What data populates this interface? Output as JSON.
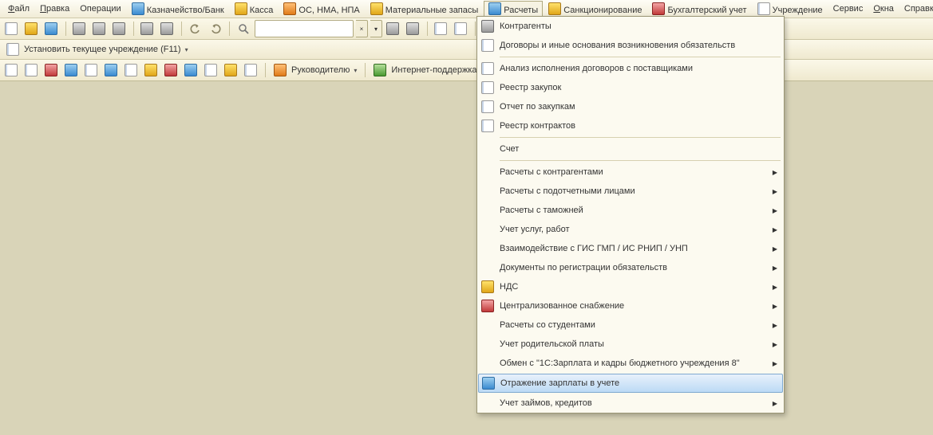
{
  "menubar": {
    "items": [
      {
        "label": "Файл",
        "underline": 0
      },
      {
        "label": "Правка",
        "underline": 0
      },
      {
        "label": "Операции"
      },
      {
        "label": "Казначейство/Банк",
        "icon": "blue"
      },
      {
        "label": "Касса",
        "icon": "yellow"
      },
      {
        "label": "ОС, НМА, НПА",
        "icon": "orange"
      },
      {
        "label": "Материальные запасы",
        "icon": "yellow"
      },
      {
        "label": "Расчеты",
        "icon": "blue",
        "active": true
      },
      {
        "label": "Санкционирование",
        "icon": "yellow"
      },
      {
        "label": "Бухгалтерский учет",
        "icon": "red"
      },
      {
        "label": "Учреждение",
        "icon": "paper"
      },
      {
        "label": "Сервис"
      },
      {
        "label": "Окна",
        "underline": 0
      },
      {
        "label": "Справка"
      }
    ]
  },
  "toolbar2_label": "Установить текущее учреждение (F11)",
  "toolbar3": {
    "leader_label": "Руководителю",
    "support_label": "Интернет-поддержка"
  },
  "dropdown": {
    "items": [
      {
        "label": "Контрагенты",
        "icon": "gray"
      },
      {
        "label": "Договоры и иные основания возникновения обязательств",
        "icon": "paper"
      },
      {
        "sep": true
      },
      {
        "label": "Анализ исполнения договоров с поставщиками",
        "icon": "paper"
      },
      {
        "label": "Реестр закупок",
        "icon": "paper"
      },
      {
        "label": "Отчет по закупкам",
        "icon": "paper"
      },
      {
        "label": "Реестр контрактов",
        "icon": "paper"
      },
      {
        "sep": true
      },
      {
        "label": "Счет"
      },
      {
        "sep": true
      },
      {
        "label": "Расчеты с контрагентами",
        "sub": true
      },
      {
        "label": "Расчеты с подотчетными лицами",
        "sub": true
      },
      {
        "label": "Расчеты с таможней",
        "sub": true
      },
      {
        "label": "Учет услуг, работ",
        "sub": true
      },
      {
        "label": "Взаимодействие с ГИС ГМП / ИС РНИП / УНП",
        "sub": true
      },
      {
        "label": "Документы по регистрации обязательств",
        "sub": true
      },
      {
        "label": "НДС",
        "icon": "yellow",
        "sub": true
      },
      {
        "label": "Централизованное снабжение",
        "icon": "red",
        "sub": true
      },
      {
        "label": "Расчеты со студентами",
        "sub": true
      },
      {
        "label": "Учет родительской платы",
        "sub": true
      },
      {
        "label": "Обмен с \"1С:Зарплата и кадры бюджетного учреждения 8\"",
        "sub": true
      },
      {
        "label": "Отражение зарплаты в учете",
        "icon": "blue",
        "highlight": true
      },
      {
        "label": "Учет займов, кредитов",
        "sub": true
      }
    ]
  }
}
